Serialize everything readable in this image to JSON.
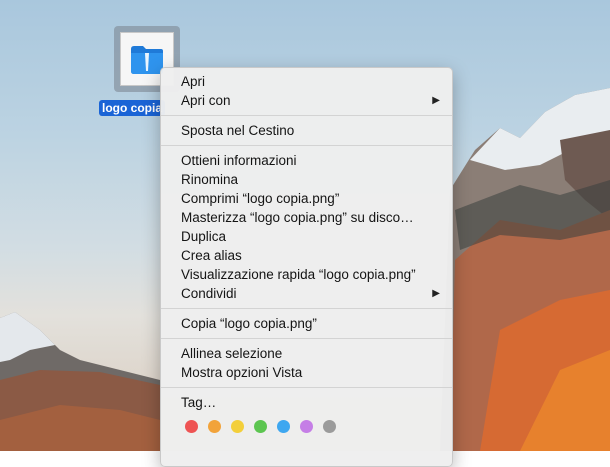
{
  "desktop": {
    "file": {
      "label": "logo copia",
      "icon": "image-file-icon"
    }
  },
  "context_menu": {
    "groups": [
      [
        {
          "label": "Apri",
          "submenu": false
        },
        {
          "label": "Apri con",
          "submenu": true
        }
      ],
      [
        {
          "label": "Sposta nel Cestino",
          "submenu": false
        }
      ],
      [
        {
          "label": "Ottieni informazioni",
          "submenu": false
        },
        {
          "label": "Rinomina",
          "submenu": false
        },
        {
          "label": "Comprimi “logo copia.png”",
          "submenu": false
        },
        {
          "label": "Masterizza “logo copia.png” su disco…",
          "submenu": false
        },
        {
          "label": "Duplica",
          "submenu": false
        },
        {
          "label": "Crea alias",
          "submenu": false
        },
        {
          "label": "Visualizzazione rapida “logo copia.png”",
          "submenu": false
        },
        {
          "label": "Condividi",
          "submenu": true
        }
      ],
      [
        {
          "label": "Copia “logo copia.png”",
          "submenu": false
        }
      ],
      [
        {
          "label": "Allinea selezione",
          "submenu": false
        },
        {
          "label": "Mostra opzioni Vista",
          "submenu": false
        }
      ],
      [
        {
          "label": "Tag…",
          "submenu": false
        }
      ]
    ],
    "submenu_arrow": "▶",
    "tag_colors": [
      "#ee5353",
      "#f2a33a",
      "#f3cf3a",
      "#5cc550",
      "#3ea7f0",
      "#c57ee6",
      "#9b9b9b"
    ]
  }
}
